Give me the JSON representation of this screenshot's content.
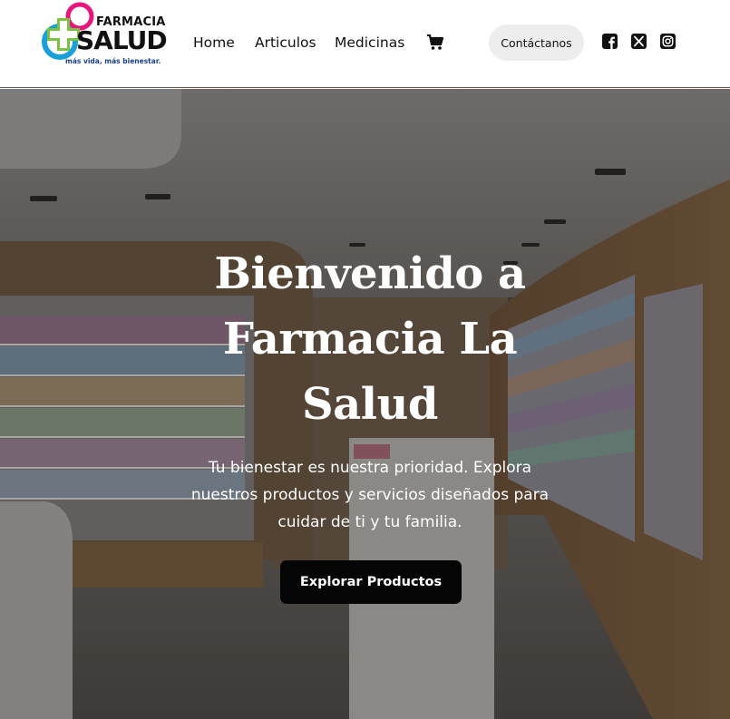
{
  "logo": {
    "word1": "FARMACIA",
    "word2": "SALUD",
    "tagline": "más vida, más bienestar."
  },
  "nav": {
    "items": [
      {
        "label": "Home"
      },
      {
        "label": "Articulos"
      },
      {
        "label": "Medicinas"
      }
    ],
    "cart_icon": "shopping-cart-icon"
  },
  "header": {
    "contact_label": "Contáctanos",
    "social": [
      "facebook-icon",
      "x-twitter-icon",
      "instagram-icon"
    ]
  },
  "hero": {
    "title": "Bienvenido a Farmacia La Salud",
    "subtitle": "Tu bienestar es nuestra prioridad. Explora nuestros productos y servicios diseñados para cuidar de ti y tu familia.",
    "cta_label": "Explorar Productos"
  },
  "colors": {
    "brand_pink": "#e5177d",
    "brand_blue": "#1a9fd9",
    "brand_green": "#7cc242",
    "cta_bg": "#050505",
    "contact_bg": "#ededed"
  }
}
